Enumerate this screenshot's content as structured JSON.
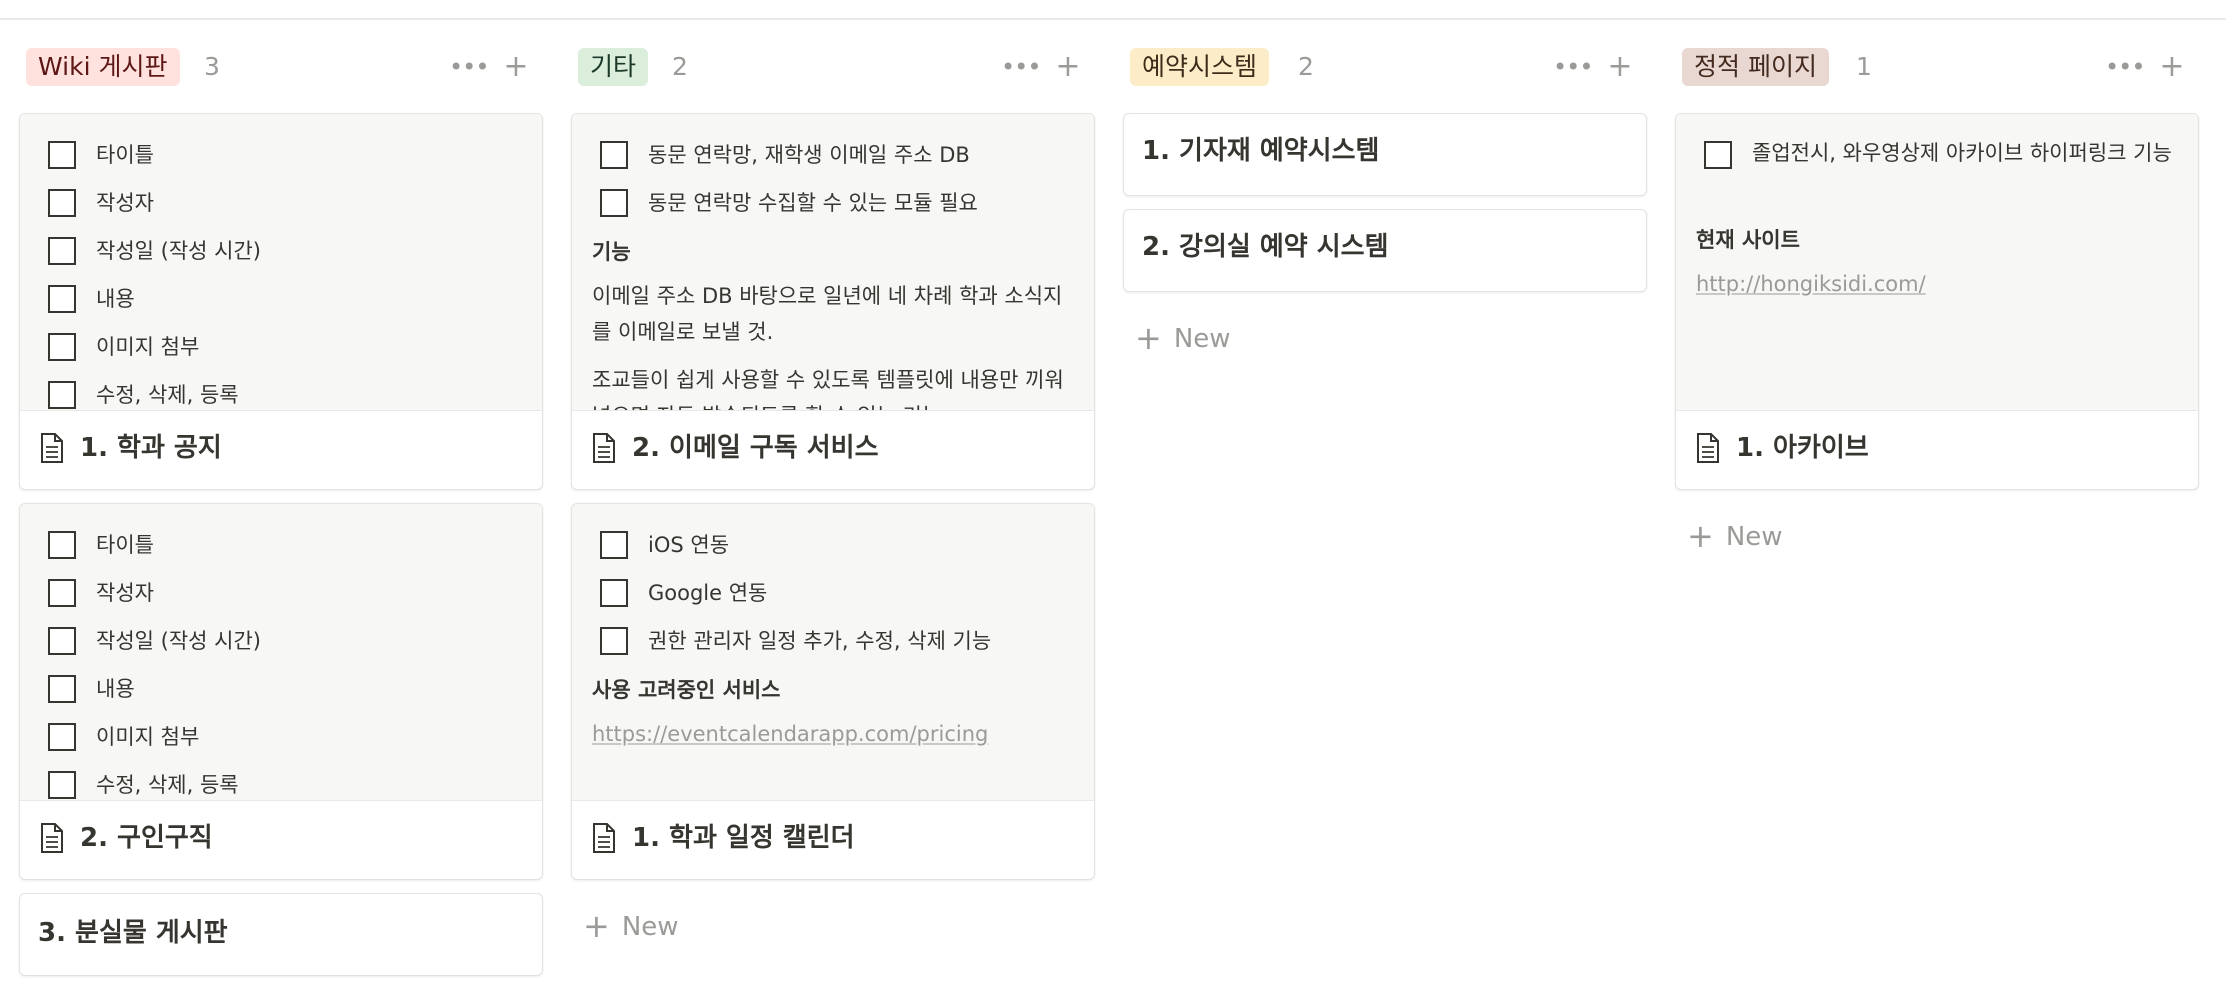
{
  "columns": [
    {
      "name": "Wiki 게시판",
      "count": "3",
      "tag_color": "#ffe2dd",
      "cards": [
        {
          "title": "1. 학과 공지",
          "checks": [
            "타이틀",
            "작성자",
            "작성일 (작성 시간)",
            "내용",
            "이미지 첨부",
            "수정, 삭제, 등록"
          ]
        },
        {
          "title": "2. 구인구직",
          "checks": [
            "타이틀",
            "작성자",
            "작성일 (작성 시간)",
            "내용",
            "이미지 첨부",
            "수정, 삭제, 등록"
          ]
        },
        {
          "title": "3. 분실물 게시판"
        }
      ]
    },
    {
      "name": "기타",
      "count": "2",
      "tag_color": "#dbeddb",
      "cards": [
        {
          "title": "2. 이메일 구독 서비스",
          "checks": [
            "동문 연락망, 재학생 이메일 주소 DB",
            "동문 연락망 수집할 수 있는 모듈 필요"
          ],
          "heading": "기능",
          "para1": "이메일 주소 DB 바탕으로 일년에 네 차례 학과 소식지를 이메일로 보낼 것.",
          "para2": "조교들이 쉽게 사용할 수 있도록 템플릿에 내용만 끼워넣으면 자동 발송되도록 할 수 있는 기능"
        },
        {
          "title": "1. 학과 일정 캘린더",
          "checks": [
            "iOS 연동",
            "Google 연동",
            "권한 관리자 일정 추가, 수정, 삭제 기능"
          ],
          "heading": "사용 고려중인 서비스",
          "link": "https://eventcalendarapp.com/pricing"
        }
      ],
      "new_label": "New"
    },
    {
      "name": "예약시스템",
      "count": "2",
      "tag_color": "#fdecc8",
      "cards": [
        {
          "title": "1. 기자재 예약시스템"
        },
        {
          "title": "2. 강의실 예약 시스템"
        }
      ],
      "new_label": "New"
    },
    {
      "name": "정적 페이지",
      "count": "1",
      "tag_color": "#e9d8d1",
      "cards": [
        {
          "title": "1. 아카이브",
          "checks": [
            "졸업전시, 와우영상제 아카이브 하이퍼링크 기능"
          ],
          "heading": "현재 사이트",
          "link": "http://hongiksidi.com/"
        }
      ],
      "new_label": "New"
    }
  ],
  "icons": {
    "more": "more-dots-icon",
    "add": "plus-icon",
    "page": "page-document-icon",
    "checkbox": "checkbox-unchecked-icon"
  },
  "glyphs": {
    "dots": "•••",
    "plus": "+"
  }
}
